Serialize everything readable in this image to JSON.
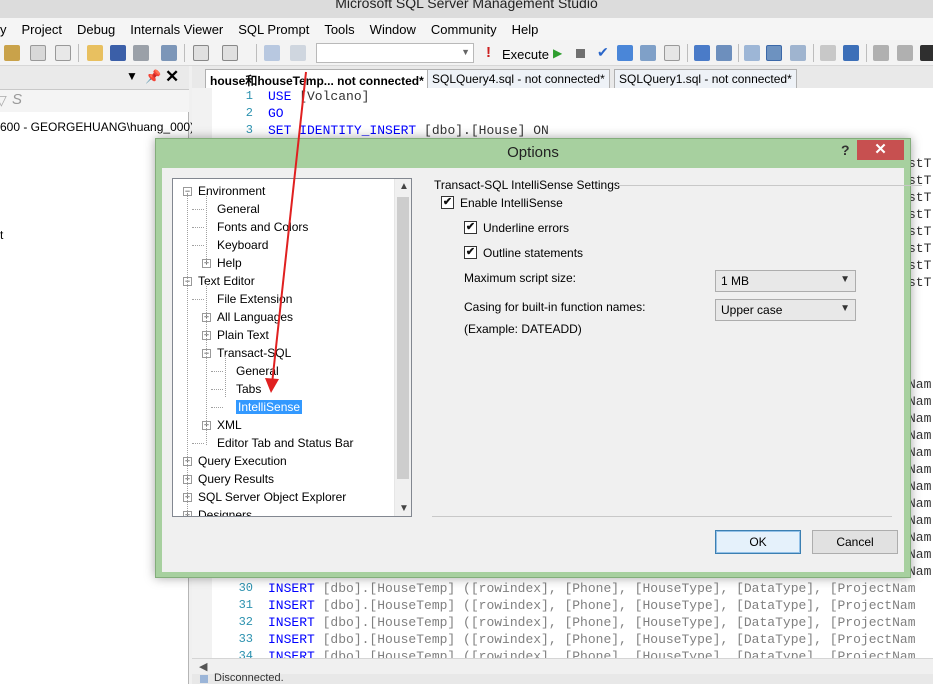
{
  "app": {
    "title": "Microsoft SQL Server Management Studio"
  },
  "menu": [
    "y",
    "Project",
    "Debug",
    "Internals Viewer",
    "SQL Prompt",
    "Tools",
    "Window",
    "Community",
    "Help"
  ],
  "toolbar": {
    "execute_label": "Execute",
    "database_combo_value": ""
  },
  "object_explorer": {
    "connection_text": "600 - GEORGEHUANG\\huang_000)",
    "partial_item": "t"
  },
  "tabs": [
    {
      "label": "house和houseTemp... not connected*"
    },
    {
      "label": "SQLQuery4.sql - not connected*"
    },
    {
      "label": "SQLQuery1.sql - not connected*"
    }
  ],
  "editor": {
    "top_lines": [
      {
        "num": "1",
        "kw": "USE",
        "rest": " [Volcano]"
      },
      {
        "num": "2",
        "kw": "GO",
        "rest": ""
      },
      {
        "num": "3",
        "kw": "SET IDENTITY_INSERT",
        "rest": " [dbo].[House] ON"
      }
    ],
    "right_tails": [
      "stT",
      "stT",
      "stT",
      "stT",
      "stT",
      "stT",
      "stT",
      "stT",
      "Nam",
      "Nam",
      "Nam",
      "Nam",
      "Nam",
      "Nam",
      "Nam",
      "Nam",
      "Nam",
      "Nam",
      "Nam",
      "Nam"
    ],
    "bottom_lines": [
      {
        "num": "30",
        "kw": "INSERT",
        "rest": " [dbo].[HouseTemp] ([rowindex], [Phone], [HouseType], [DataType], [ProjectNam"
      },
      {
        "num": "31",
        "kw": "INSERT",
        "rest": " [dbo].[HouseTemp] ([rowindex], [Phone], [HouseType], [DataType], [ProjectNam"
      },
      {
        "num": "32",
        "kw": "INSERT",
        "rest": " [dbo].[HouseTemp] ([rowindex], [Phone], [HouseType], [DataType], [ProjectNam"
      },
      {
        "num": "33",
        "kw": "INSERT",
        "rest": " [dbo].[HouseTemp] ([rowindex], [Phone], [HouseType], [DataType], [ProjectNam"
      },
      {
        "num": "34",
        "kw": "INSERT",
        "rest": " [dbo].[HouseTemp] ([rowindex], [Phone], [HouseType], [DataType], [ProjectNam"
      }
    ],
    "status_text": "Disconnected."
  },
  "dialog": {
    "title": "Options",
    "help": "?",
    "close": "✕",
    "tree": [
      {
        "label": "Environment",
        "expander": "−"
      },
      {
        "label": "General"
      },
      {
        "label": "Fonts and Colors"
      },
      {
        "label": "Keyboard"
      },
      {
        "label": "Help",
        "expander": "+"
      },
      {
        "label": "Text Editor",
        "expander": "−"
      },
      {
        "label": "File Extension"
      },
      {
        "label": "All Languages",
        "expander": "+"
      },
      {
        "label": "Plain Text",
        "expander": "+"
      },
      {
        "label": "Transact-SQL",
        "expander": "−"
      },
      {
        "label": "General"
      },
      {
        "label": "Tabs"
      },
      {
        "label": "IntelliSense",
        "selected": true
      },
      {
        "label": "XML",
        "expander": "+"
      },
      {
        "label": "Editor Tab and Status Bar"
      },
      {
        "label": "Query Execution",
        "expander": "+"
      },
      {
        "label": "Query Results",
        "expander": "+"
      },
      {
        "label": "SQL Server Object Explorer",
        "expander": "+"
      },
      {
        "label": "Designers",
        "expander": "+"
      }
    ],
    "settings": {
      "section_title": "Transact-SQL IntelliSense Settings",
      "enable_intellisense": {
        "label": "Enable IntelliSense",
        "checked": true
      },
      "underline_errors": {
        "label": "Underline errors",
        "checked": true
      },
      "outline_statements": {
        "label": "Outline statements",
        "checked": true
      },
      "max_script_size": {
        "label": "Maximum script size:",
        "value": "1 MB"
      },
      "casing": {
        "label": "Casing for built-in function names:",
        "value": "Upper case"
      },
      "example": "(Example: DATEADD)"
    },
    "ok_label": "OK",
    "cancel_label": "Cancel"
  },
  "colors": {
    "dialog_frame": "#a7d09f",
    "selection": "#3399ff",
    "close_button": "#c75050",
    "annotation_arrow": "#e02020"
  }
}
